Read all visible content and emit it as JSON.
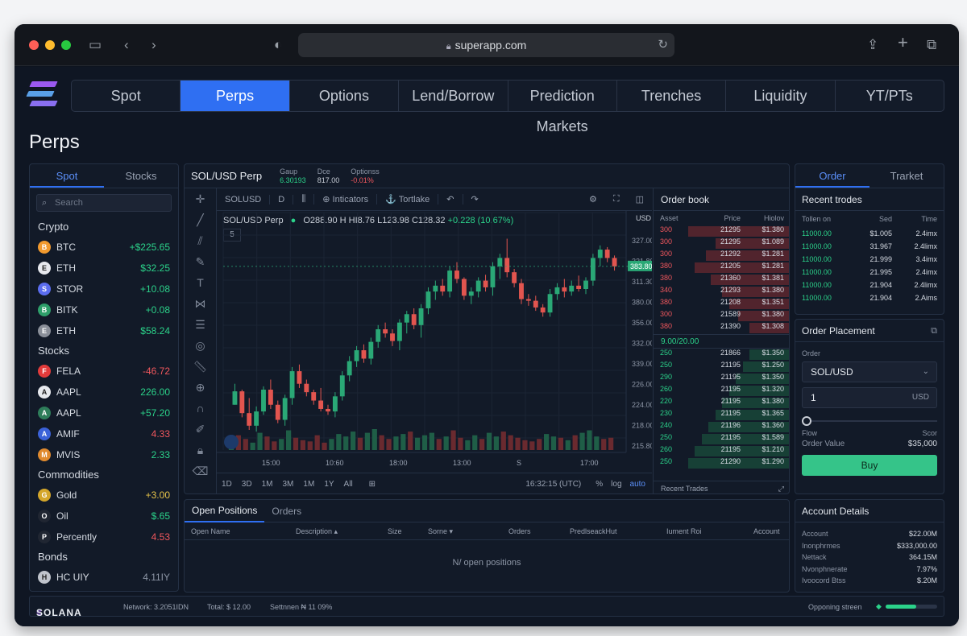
{
  "browser": {
    "url": "superapp.com"
  },
  "nav": {
    "tabs": [
      "Spot",
      "Perps",
      "Options",
      "Lend/Borrow",
      "Prediction Markets",
      "Trenches",
      "Liquidity",
      "YT/PTs"
    ],
    "active": "Perps"
  },
  "page": {
    "title": "Perps"
  },
  "markets": {
    "tabs": [
      "Spot",
      "Stocks"
    ],
    "search_placeholder": "Search",
    "sections": [
      {
        "title": "Crypto",
        "items": [
          {
            "symbol": "BTC",
            "change": "+$225.65",
            "dir": "up",
            "icon_color": "#f29a2e",
            "icon": "bitcoin-icon"
          },
          {
            "symbol": "ETH",
            "change": "$32.25",
            "dir": "up",
            "icon_color": "#e7e9ee",
            "icon": "ethereum-icon"
          },
          {
            "symbol": "STOR",
            "change": "+10.08",
            "dir": "up",
            "icon_color": "#5b6df0",
            "icon": "stor-icon"
          },
          {
            "symbol": "BITK",
            "change": "+0.08",
            "dir": "up",
            "icon_color": "#2e9f6a",
            "icon": "bitk-icon"
          },
          {
            "symbol": "ETH",
            "change": "$58.24",
            "dir": "up",
            "icon_color": "#8a8f99",
            "icon": "ethereum-icon"
          }
        ]
      },
      {
        "title": "Stocks",
        "items": [
          {
            "symbol": "FELA",
            "change": "-46.72",
            "dir": "down",
            "icon_color": "#e23b3b",
            "icon": "tesla-icon"
          },
          {
            "symbol": "AAPL",
            "change": "226.00",
            "dir": "up",
            "icon_color": "#e7e9ee",
            "icon": "apple-icon"
          },
          {
            "symbol": "AAPL",
            "change": "+57.20",
            "dir": "up",
            "icon_color": "#2e7d5a",
            "icon": "aapl-icon"
          },
          {
            "symbol": "AMIF",
            "change": "4.33",
            "dir": "down",
            "icon_color": "#3b62d8",
            "icon": "amif-icon"
          },
          {
            "symbol": "MVIS",
            "change": "2.33",
            "dir": "up",
            "icon_color": "#e08a2e",
            "icon": "mvis-icon"
          }
        ]
      },
      {
        "title": "Commodities",
        "items": [
          {
            "symbol": "Gold",
            "change": "+3.00",
            "dir": "gold",
            "icon_color": "#d4a62a",
            "icon": "gold-icon"
          },
          {
            "symbol": "Oil",
            "change": "$.65",
            "dir": "up",
            "icon_color": "#202632",
            "icon": "oil-drop-icon"
          },
          {
            "symbol": "Percently",
            "change": "4.53",
            "dir": "down",
            "icon_color": "#202632",
            "icon": "percent-icon"
          }
        ]
      },
      {
        "title": "Bonds",
        "items": [
          {
            "symbol": "HC UIY",
            "change": "4.11IY",
            "dir": "flat",
            "icon_color": "#c0c4cc",
            "icon": "us-flag-icon"
          }
        ]
      }
    ]
  },
  "chart": {
    "pair": "SOL/USD Perp",
    "stats": [
      {
        "label": "Gaup",
        "value": "6.30193",
        "dir": "up"
      },
      {
        "label": "Dce",
        "value": "817.00",
        "dir": "flat"
      },
      {
        "label": "Optionss",
        "value": "-0.01%",
        "dir": "down"
      }
    ],
    "toolbar": {
      "symbol": "SOLUSD",
      "interval": "D",
      "indicators": "Inticators",
      "trade": "Tortlake"
    },
    "legend": {
      "pair": "SOL/USD Perp",
      "o": "O288.90",
      "h": "H HI8.76",
      "l": "L123.98",
      "c": "C128.32",
      "change": "+0.228 (10.67%)",
      "interval": "5"
    },
    "ranges": [
      "1D",
      "3D",
      "1M",
      "3M",
      "1M",
      "1Y",
      "All"
    ],
    "time": "16:32:15 (UTC)",
    "scale_opts": [
      "%",
      "log",
      "auto"
    ],
    "price_unit": "USD",
    "price_axis": [
      "327.00",
      "321.80",
      "311.30",
      "380.00",
      "356.00",
      "332.00",
      "339.00",
      "226.00",
      "224.00",
      "218.00",
      "215.80"
    ],
    "current_price": "383.80",
    "time_axis": [
      "15:00",
      "10:60",
      "18:00",
      "13:00",
      "S",
      "17:00"
    ]
  },
  "chart_data": {
    "type": "candlestick",
    "title": "SOL/USD Perp",
    "ylabel": "USD",
    "x_ticks": [
      "15:00",
      "10:60",
      "18:00",
      "13:00",
      "S",
      "17:00"
    ],
    "candles": [
      [
        120,
        120,
        145,
        136
      ],
      [
        136,
        105,
        138,
        110
      ],
      [
        110,
        90,
        128,
        95
      ],
      [
        95,
        88,
        118,
        112
      ],
      [
        112,
        108,
        142,
        138
      ],
      [
        138,
        115,
        150,
        120
      ],
      [
        120,
        98,
        125,
        102
      ],
      [
        102,
        95,
        132,
        128
      ],
      [
        128,
        120,
        165,
        160
      ],
      [
        160,
        140,
        168,
        145
      ],
      [
        145,
        130,
        150,
        135
      ],
      [
        135,
        120,
        138,
        125
      ],
      [
        125,
        112,
        140,
        115
      ],
      [
        115,
        108,
        120,
        112
      ],
      [
        112,
        105,
        135,
        130
      ],
      [
        130,
        125,
        160,
        155
      ],
      [
        155,
        148,
        178,
        172
      ],
      [
        172,
        165,
        190,
        185
      ],
      [
        185,
        170,
        192,
        175
      ],
      [
        175,
        168,
        200,
        195
      ],
      [
        195,
        188,
        215,
        210
      ],
      [
        210,
        200,
        218,
        205
      ],
      [
        205,
        190,
        210,
        196
      ],
      [
        196,
        185,
        222,
        218
      ],
      [
        218,
        205,
        232,
        228
      ],
      [
        228,
        210,
        235,
        215
      ],
      [
        215,
        200,
        240,
        235
      ],
      [
        235,
        228,
        260,
        255
      ],
      [
        255,
        245,
        268,
        262
      ],
      [
        262,
        250,
        270,
        255
      ],
      [
        255,
        248,
        285,
        280
      ],
      [
        280,
        265,
        290,
        270
      ],
      [
        270,
        245,
        272,
        250
      ],
      [
        250,
        240,
        260,
        255
      ],
      [
        255,
        248,
        272,
        268
      ],
      [
        268,
        255,
        275,
        260
      ],
      [
        260,
        250,
        290,
        285
      ],
      [
        285,
        270,
        300,
        295
      ],
      [
        295,
        272,
        318,
        278
      ],
      [
        278,
        260,
        282,
        265
      ],
      [
        265,
        240,
        270,
        246
      ],
      [
        246,
        238,
        252,
        244
      ],
      [
        244,
        232,
        250,
        236
      ],
      [
        236,
        225,
        240,
        230
      ],
      [
        230,
        225,
        258,
        252
      ],
      [
        252,
        245,
        265,
        260
      ],
      [
        260,
        248,
        270,
        255
      ],
      [
        255,
        250,
        268,
        262
      ],
      [
        262,
        255,
        274,
        258
      ],
      [
        258,
        252,
        272,
        268
      ],
      [
        268,
        262,
        300,
        295
      ],
      [
        295,
        285,
        310,
        305
      ],
      [
        305,
        290,
        308,
        295
      ],
      [
        295,
        280,
        298,
        285
      ]
    ],
    "volume": [
      8,
      12,
      9,
      6,
      14,
      11,
      7,
      9,
      16,
      10,
      8,
      7,
      12,
      6,
      9,
      13,
      11,
      15,
      10,
      14,
      17,
      12,
      9,
      11,
      13,
      15,
      10,
      12,
      14,
      9,
      11,
      16,
      10,
      8,
      12,
      9,
      14,
      11,
      15,
      12,
      10,
      8,
      7,
      9,
      13,
      11,
      10,
      8,
      12,
      14,
      16,
      11,
      9,
      10
    ],
    "ylim": [
      90,
      330
    ]
  },
  "orderbook": {
    "title": "Order book",
    "columns": [
      "Asset",
      "Price",
      "Hiolov"
    ],
    "asks": [
      {
        "a": "300",
        "p": "21295",
        "s": "$1.380",
        "w": 0.75
      },
      {
        "a": "300",
        "p": "21295",
        "s": "$1.089",
        "w": 0.55
      },
      {
        "a": "300",
        "p": "21292",
        "s": "$1.281",
        "w": 0.62
      },
      {
        "a": "380",
        "p": "21205",
        "s": "$1.281",
        "w": 0.7
      },
      {
        "a": "380",
        "p": "21360",
        "s": "$1.381",
        "w": 0.58
      },
      {
        "a": "340",
        "p": "21293",
        "s": "$1.380",
        "w": 0.5
      },
      {
        "a": "380",
        "p": "21208",
        "s": "$1.351",
        "w": 0.45
      },
      {
        "a": "300",
        "p": "21589",
        "s": "$1.380",
        "w": 0.38
      },
      {
        "a": "380",
        "p": "21390",
        "s": "$1.308",
        "w": 0.3
      }
    ],
    "spread": "9.00/20.00",
    "bids": [
      {
        "a": "250",
        "p": "21866",
        "s": "$1.350",
        "w": 0.3
      },
      {
        "a": "250",
        "p": "21195",
        "s": "$1.250",
        "w": 0.35
      },
      {
        "a": "290",
        "p": "21195",
        "s": "$1.350",
        "w": 0.4
      },
      {
        "a": "260",
        "p": "21195",
        "s": "$1.320",
        "w": 0.45
      },
      {
        "a": "220",
        "p": "21195",
        "s": "$1.380",
        "w": 0.5
      },
      {
        "a": "230",
        "p": "21195",
        "s": "$1.365",
        "w": 0.55
      },
      {
        "a": "240",
        "p": "21196",
        "s": "$1.360",
        "w": 0.6
      },
      {
        "a": "250",
        "p": "21195",
        "s": "$1.589",
        "w": 0.65
      },
      {
        "a": "260",
        "p": "21195",
        "s": "$1.210",
        "w": 0.7
      },
      {
        "a": "250",
        "p": "21290",
        "s": "$1.290",
        "w": 0.75
      }
    ],
    "footer": "Recent Trades"
  },
  "trades": {
    "tabs": [
      "Order",
      "Trarket"
    ],
    "title": "Recent trodes",
    "columns": [
      "Tollen on",
      "Sed",
      "Time"
    ],
    "rows": [
      {
        "a": "11000.00",
        "b": "$1.005",
        "t": "2.4imx"
      },
      {
        "a": "11000.00",
        "b": "31.967",
        "t": "2.4limx"
      },
      {
        "a": "11000.00",
        "b": "21.999",
        "t": "3.4imx"
      },
      {
        "a": "11000.00",
        "b": "21.995",
        "t": "2.4imx"
      },
      {
        "a": "11000.00",
        "b": "21.904",
        "t": "2.4limx"
      },
      {
        "a": "11000.00",
        "b": "21.904",
        "t": "2.Aims"
      }
    ]
  },
  "order": {
    "title": "Order Placement",
    "label": "Order",
    "pair": "SOL/USD",
    "amount": "1",
    "unit": "USD",
    "slider_level": 0,
    "flow_label": "Flow",
    "flow_right": "Scor",
    "value_label": "Order Value",
    "value": "$35,000",
    "buy": "Buy"
  },
  "account": {
    "title": "Account Details",
    "rows": [
      {
        "k": "Account",
        "v": "$22.00M"
      },
      {
        "k": "Inonphrmes",
        "v": "$333,000.00"
      },
      {
        "k": "Nettack",
        "v": "364.15M"
      },
      {
        "k": "Nvonphnerate",
        "v": "7.97%"
      },
      {
        "k": "Ivoocord Btss",
        "v": "$.20M"
      }
    ]
  },
  "positions": {
    "tabs": [
      "Open Positions",
      "Orders"
    ],
    "columns": [
      "Open Name",
      "Description",
      "Size",
      "Sorne",
      "Orders",
      "PredlseackHut",
      "Iument Roi",
      "Account"
    ],
    "empty": "N/ open positions"
  },
  "status": {
    "brand": "SOLANA",
    "network": "Network: 3.2051IDN",
    "total": "Total: $ 12.00",
    "settlement": "Settnnen ₦ 11 09%",
    "right": "Opponing streen",
    "progress": 0.6
  },
  "colors": {
    "accent": "#2f6ff2",
    "up": "#2bd28a",
    "down": "#f0575d",
    "buy": "#35c489"
  }
}
